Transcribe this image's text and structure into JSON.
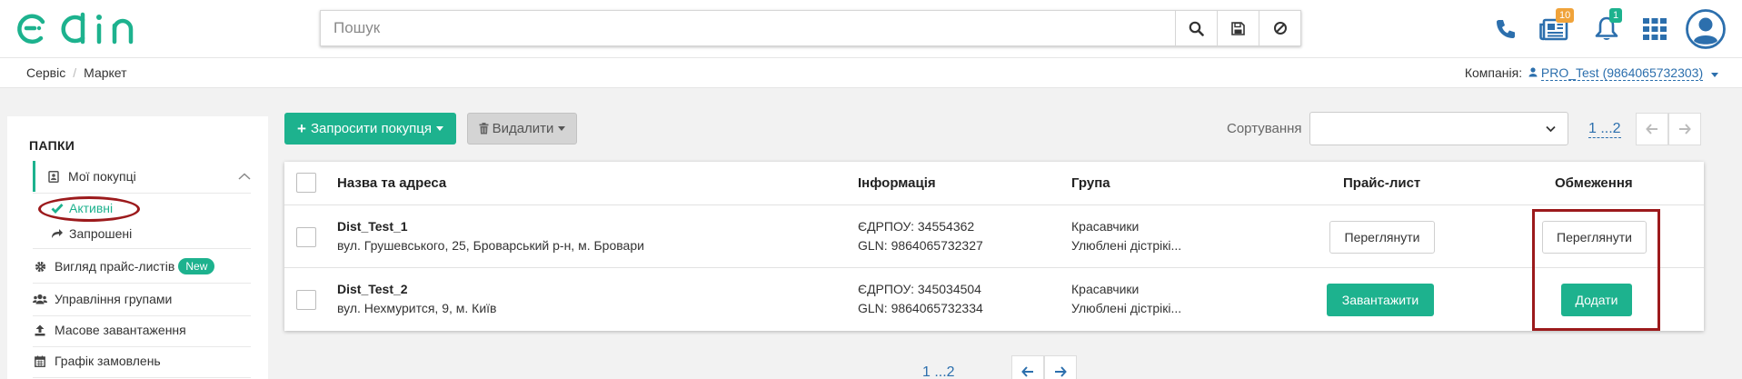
{
  "header": {
    "logo_text": "edin",
    "search_placeholder": "Пошук",
    "news_badge": "10",
    "notifications_badge": "1",
    "colors": {
      "brand": "#1db28e",
      "news_badge": "#f0a33a",
      "notifications_badge": "#1db28e",
      "icon_blue": "#2c6fad"
    }
  },
  "breadcrumb": {
    "items": [
      "Сервіс",
      "Маркет"
    ]
  },
  "company": {
    "label": "Компанія:",
    "value": "PRO_Test (9864065732303)"
  },
  "sidebar": {
    "title": "ПАПКИ",
    "folder": "Мої покупці",
    "sub_active": "Активні",
    "sub_invited": "Запрошені",
    "items": [
      {
        "label": "Вигляд прайс-листів",
        "badge": "New",
        "icon": "gear-icon"
      },
      {
        "label": "Управління групами",
        "icon": "users-icon"
      },
      {
        "label": "Масове завантаження",
        "icon": "upload-icon"
      },
      {
        "label": "Графік замовлень",
        "icon": "calendar-icon"
      }
    ]
  },
  "toolbar": {
    "invite_label": "Запросити покупця",
    "delete_label": "Видалити",
    "sort_label": "Сортування",
    "sort_value": "",
    "pager_label": "1 ...2"
  },
  "table": {
    "headers": [
      "Назва та адреса",
      "Інформація",
      "Група",
      "Прайс-лист",
      "Обмеження"
    ],
    "rows": [
      {
        "name": "Dist_Test_1",
        "address": "вул. Грушевського, 25, Броварський р-н, м. Бровари",
        "edrpou": "ЄДРПОУ: 34554362",
        "gln": "GLN: 9864065732327",
        "group1": "Красавчики",
        "group2": "Улюблені дістрікі...",
        "price_action": "Переглянути",
        "limit_action": "Переглянути"
      },
      {
        "name": "Dist_Test_2",
        "address": "вул. Нехмурится, 9, м. Київ",
        "edrpou": "ЄДРПОУ: 345034504",
        "gln": "GLN: 9864065732334",
        "group1": "Красавчики",
        "group2": "Улюблені дістрікі...",
        "price_action": "Завантажити",
        "limit_action": "Додати"
      }
    ]
  },
  "bottom_pager": {
    "label": "1 ...2"
  }
}
